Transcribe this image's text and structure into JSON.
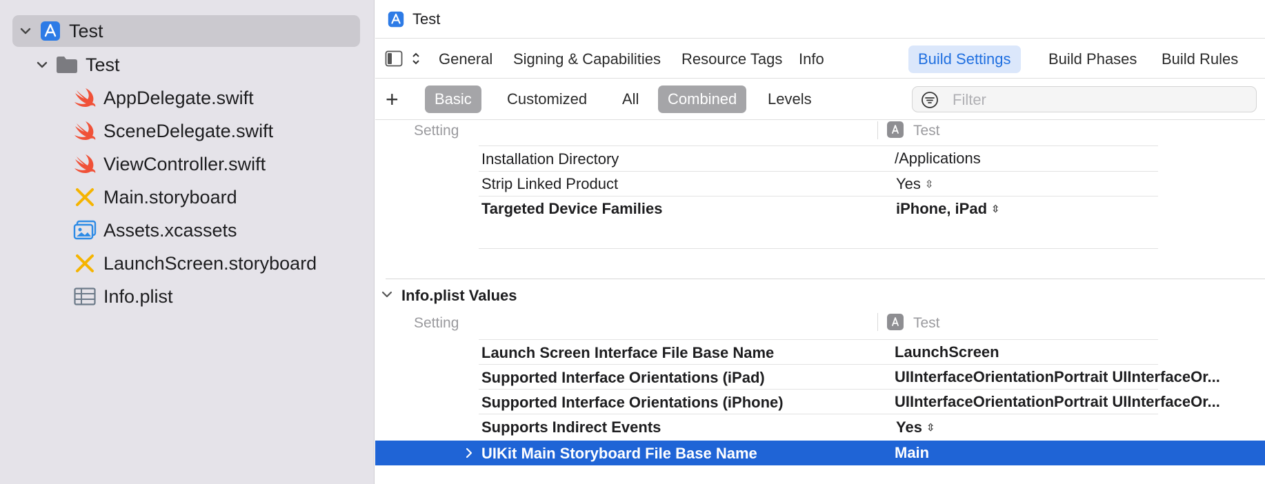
{
  "sidebar": {
    "project": {
      "name": "Test"
    },
    "group": {
      "name": "Test"
    },
    "files": [
      {
        "name": "AppDelegate.swift",
        "icon": "swift-icon"
      },
      {
        "name": "SceneDelegate.swift",
        "icon": "swift-icon"
      },
      {
        "name": "ViewController.swift",
        "icon": "swift-icon"
      },
      {
        "name": "Main.storyboard",
        "icon": "storyboard-icon"
      },
      {
        "name": "Assets.xcassets",
        "icon": "asset-catalog-icon"
      },
      {
        "name": "LaunchScreen.storyboard",
        "icon": "storyboard-icon"
      },
      {
        "name": "Info.plist",
        "icon": "plist-icon"
      }
    ]
  },
  "titlebar": {
    "title": "Test"
  },
  "tabs": [
    "General",
    "Signing & Capabilities",
    "Resource Tags",
    "Info",
    "Build Settings",
    "Build Phases",
    "Build Rules"
  ],
  "active_tab": "Build Settings",
  "filterbar": {
    "add_label": "+",
    "scope": [
      "Basic",
      "Customized",
      "All"
    ],
    "scope_selected": "Basic",
    "view": [
      "Combined",
      "Levels"
    ],
    "view_selected": "Combined",
    "filter_placeholder": "Filter"
  },
  "deployment": {
    "header_setting": "Setting",
    "header_target": "Test",
    "rows": [
      {
        "setting": "Installation Directory",
        "value": "/Applications",
        "bold": false,
        "stepper": false
      },
      {
        "setting": "Strip Linked Product",
        "value": "Yes",
        "bold": false,
        "stepper": true
      },
      {
        "setting": "Targeted Device Families",
        "value": "iPhone, iPad",
        "bold": true,
        "stepper": true
      }
    ]
  },
  "info_plist": {
    "section_title": "Info.plist Values",
    "header_setting": "Setting",
    "header_target": "Test",
    "rows": [
      {
        "setting": "Launch Screen Interface File Base Name",
        "value": "LaunchScreen",
        "stepper": false
      },
      {
        "setting": "Supported Interface Orientations (iPad)",
        "value": "UIInterfaceOrientationPortrait UIInterfaceOr...",
        "stepper": false
      },
      {
        "setting": "Supported Interface Orientations (iPhone)",
        "value": "UIInterfaceOrientationPortrait UIInterfaceOr...",
        "stepper": false
      },
      {
        "setting": "Supports Indirect Events",
        "value": "Yes",
        "stepper": true
      },
      {
        "setting": "UIKit Main Storyboard File Base Name",
        "value": "Main",
        "stepper": false,
        "selected": true
      }
    ]
  },
  "colors": {
    "accent": "#1f64d6",
    "active_tab_bg": "#dbe7fb",
    "sidebar_bg": "#e5e3e9",
    "swift": "#f05138",
    "storyboard": "#f5b400"
  }
}
